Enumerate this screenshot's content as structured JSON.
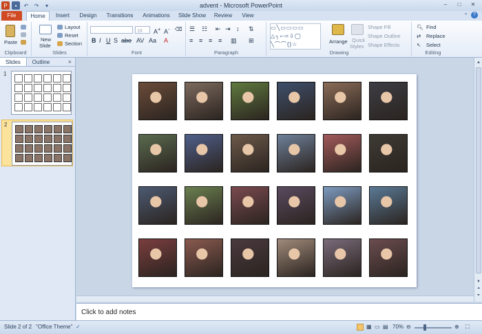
{
  "window": {
    "title": "advent - Microsoft PowerPoint",
    "min_icon": "minimize-icon",
    "max_icon": "maximize-icon",
    "close_icon": "close-icon"
  },
  "ribbon_tabs": [
    {
      "label": "File"
    },
    {
      "label": "Home"
    },
    {
      "label": "Insert"
    },
    {
      "label": "Design"
    },
    {
      "label": "Transitions"
    },
    {
      "label": "Animations"
    },
    {
      "label": "Slide Show"
    },
    {
      "label": "Review"
    },
    {
      "label": "View"
    }
  ],
  "ribbon": {
    "paste": "Paste",
    "new_slide": "New",
    "new_slide2": "Slide",
    "layout": "Layout",
    "reset": "Reset",
    "section": "Section",
    "font_size": "18",
    "arrange": "Arrange",
    "quick_styles": "Quick",
    "quick_styles2": "Styles",
    "shape_fill": "Shape Fill",
    "shape_outline": "Shape Outline",
    "shape_effects": "Shape Effects",
    "find": "Find",
    "replace": "Replace",
    "select": "Select",
    "groups": {
      "clipboard": "Clipboard",
      "slides": "Slides",
      "font": "Font",
      "paragraph": "Paragraph",
      "drawing": "Drawing",
      "editing": "Editing"
    }
  },
  "panel": {
    "tab_slides": "Slides",
    "tab_outline": "Outline",
    "close": "×",
    "slide1_num": "1",
    "slide2_num": "2"
  },
  "notes": {
    "placeholder": "Click to add notes"
  },
  "status": {
    "slide": "Slide 2 of 2",
    "theme": "\"Office Theme\"",
    "zoom": "70%"
  },
  "slide": {
    "photos_rows": [
      [
        "#6b4c3a",
        "#7d6a5e",
        "#5f7a3e",
        "#3e4f6b",
        "#8b6c58",
        "#3d3d44"
      ],
      [
        "#5a6b4f",
        "#4f5f8a",
        "#6d5a4a",
        "#6e8099",
        "#a25a5a",
        "#3e3a34"
      ],
      [
        "#4c5a72",
        "#6b8050",
        "#7a4a4f",
        "#5a4a5f",
        "#7d9bc0",
        "#5a7a96"
      ],
      [
        "#7a3e3e",
        "#8a5a4f",
        "#4a3a3e",
        "#a08a7a",
        "#7a6b7a",
        "#6b4c4f"
      ]
    ]
  }
}
